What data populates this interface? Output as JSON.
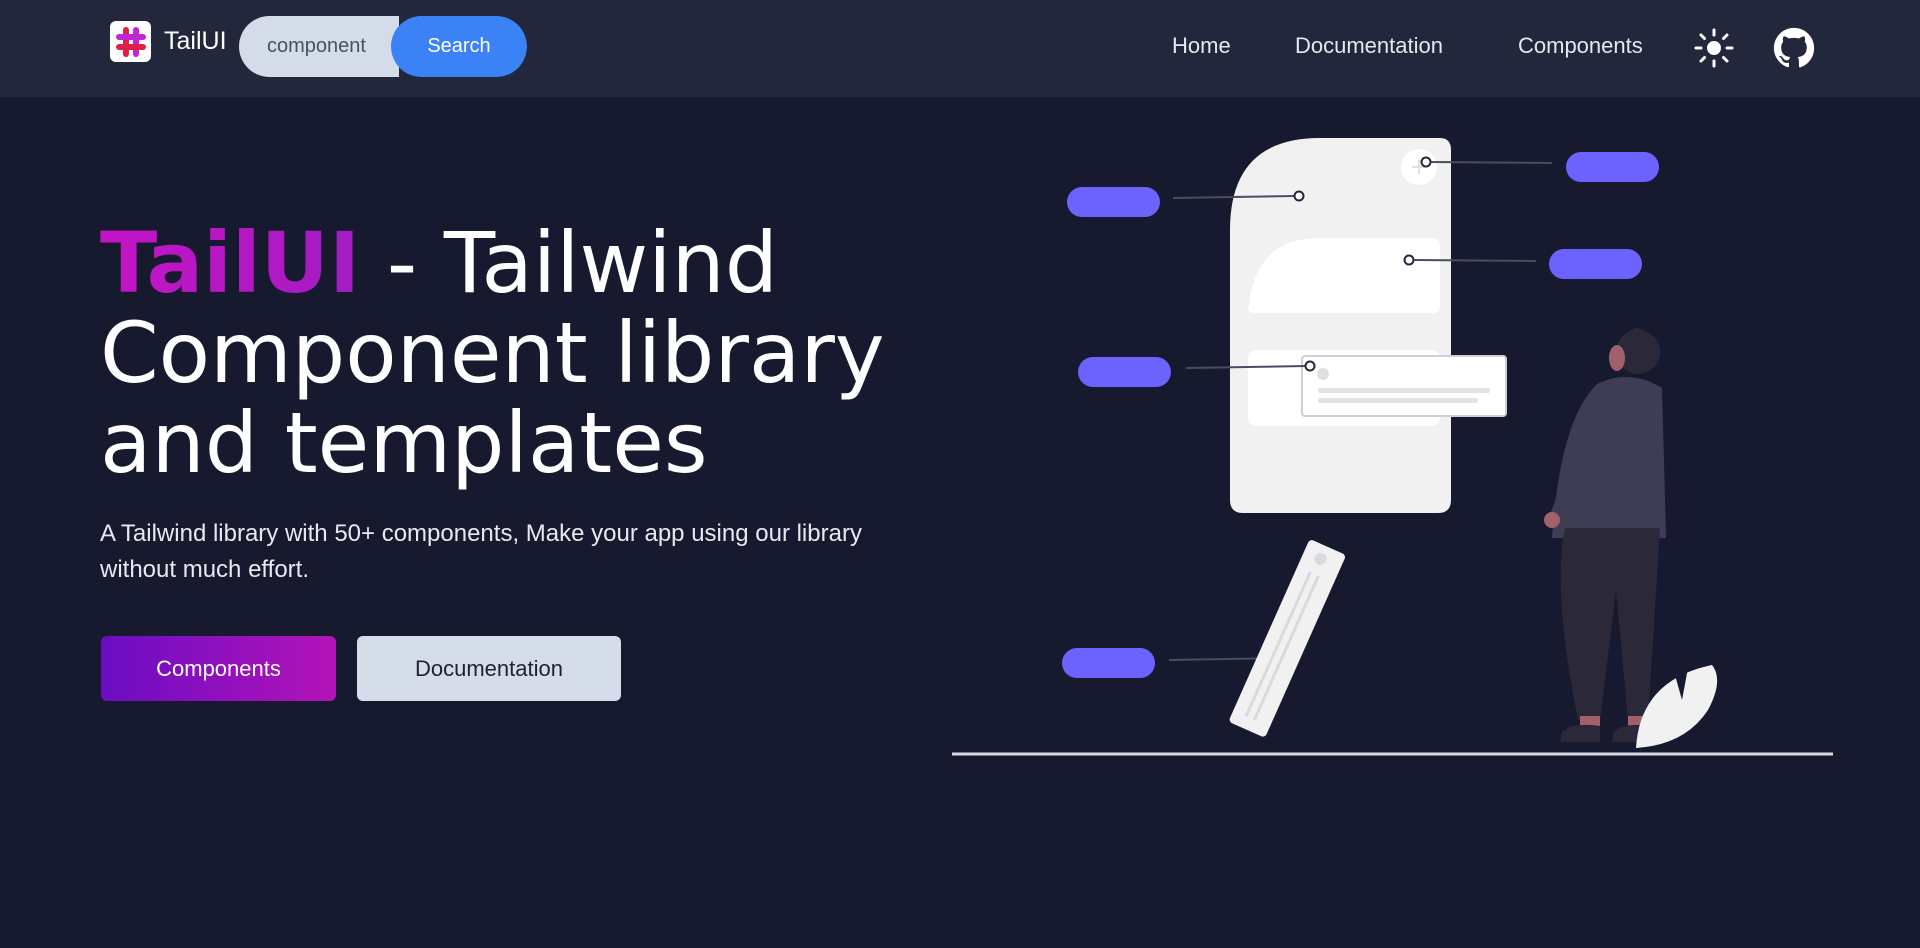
{
  "brand": {
    "name": "TailUI"
  },
  "search": {
    "value": "component",
    "button_label": "Search"
  },
  "nav": {
    "links": [
      {
        "label": "Home"
      },
      {
        "label": "Documentation"
      },
      {
        "label": "Components"
      }
    ],
    "icons": [
      "sun-icon",
      "github-icon"
    ]
  },
  "hero": {
    "title_brand": "TailUI",
    "title_rest_line1": " - Tailwind",
    "title_line2": "Component library",
    "title_line3": "and templates",
    "subtitle": "A Tailwind library with 50+ components, Make your app using our library without much effort.",
    "primary_button": "Components",
    "secondary_button": "Documentation"
  },
  "colors": {
    "background": "#171a2e",
    "navbar": "#23273b",
    "accent_blue": "#3b82f6",
    "brand_gradient_start": "#6a0dc2",
    "brand_gradient_end": "#b413b8",
    "illustration_accent": "#6c63ff"
  }
}
